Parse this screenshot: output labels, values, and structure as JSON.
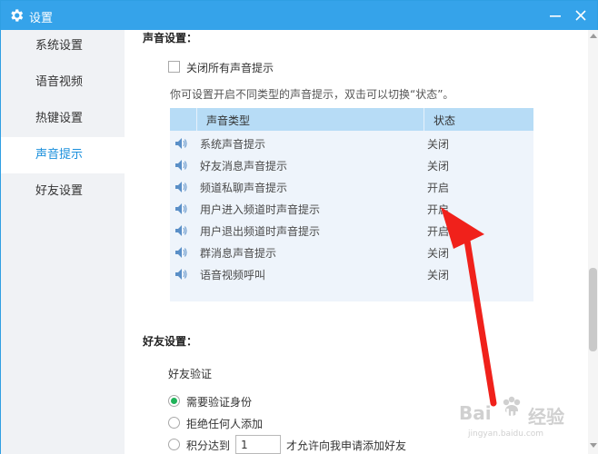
{
  "window": {
    "title": "设置"
  },
  "sidebar": {
    "items": [
      {
        "label": "系统设置",
        "active": false
      },
      {
        "label": "语音视频",
        "active": false
      },
      {
        "label": "热键设置",
        "active": false
      },
      {
        "label": "声音提示",
        "active": true
      },
      {
        "label": "好友设置",
        "active": false
      }
    ]
  },
  "sound": {
    "section_title": "声音设置：",
    "mute_all_label": "关闭所有声音提示",
    "mute_all_checked": false,
    "hint": "你可设置开启不同类型的声音提示，双击可以切换“状态”。",
    "table": {
      "col_type": "声音类型",
      "col_status": "状态",
      "rows": [
        {
          "name": "系统声音提示",
          "status": "关闭"
        },
        {
          "name": "好友消息声音提示",
          "status": "关闭"
        },
        {
          "name": "频道私聊声音提示",
          "status": "开启"
        },
        {
          "name": "用户进入频道时声音提示",
          "status": "开启"
        },
        {
          "name": "用户退出频道时声音提示",
          "status": "开启"
        },
        {
          "name": "群消息声音提示",
          "status": "关闭"
        },
        {
          "name": "语音视频呼叫",
          "status": "关闭"
        }
      ]
    }
  },
  "friend": {
    "section_title": "好友设置：",
    "verify_label": "好友验证",
    "options": [
      {
        "label": "需要验证身份",
        "checked": true
      },
      {
        "label": "拒绝任何人添加",
        "checked": false
      },
      {
        "label": "积分达到",
        "checked": false
      }
    ],
    "points_value": "1",
    "points_suffix": "才允许向我申请添加好友"
  },
  "colors": {
    "titlebar": "#35a3ea",
    "active_nav_text": "#1a8fdc",
    "table_header": "#b7dcf6",
    "annotation_arrow": "#f0211b"
  },
  "watermark": {
    "brand": "Bai",
    "paw": "du",
    "domain_text": "经验",
    "sub": "jingyan.baidu.com"
  }
}
